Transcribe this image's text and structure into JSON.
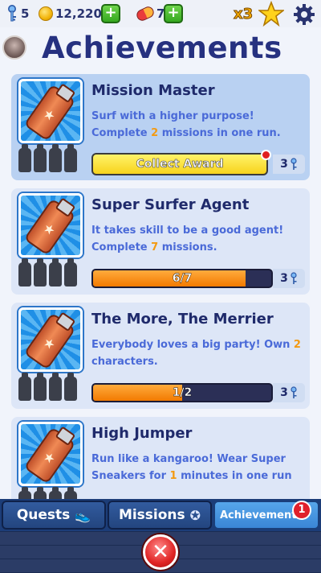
{
  "topbar": {
    "keys": "5",
    "coins": "12,220",
    "boards": "7",
    "multiplier": "x3",
    "plus": "+"
  },
  "header": {
    "title": "Achievements"
  },
  "achievements": [
    {
      "title": "Mission Master",
      "desc_pre": "Surf with a higher purpose! Complete ",
      "desc_num": "2",
      "desc_post": " missions in one run.",
      "action": "Collect Award",
      "reward": "3",
      "progress_fraction": 1.0
    },
    {
      "title": "Super Surfer Agent",
      "desc_pre": "It takes skill to be a good agent! Complete ",
      "desc_num": "7",
      "desc_post": " missions.",
      "progress": "6/7",
      "progress_fraction": 0.857,
      "reward": "3"
    },
    {
      "title": "The More, The Merrier",
      "desc_pre": "Everybody loves a big party! Own ",
      "desc_num": "2",
      "desc_post": " characters.",
      "progress": "1/2",
      "progress_fraction": 0.5,
      "reward": "3"
    },
    {
      "title": "High Jumper",
      "desc_pre": "Run like a kangaroo! Wear Super Sneakers for ",
      "desc_num": "1",
      "desc_post": " minutes in one run"
    }
  ],
  "tabs": [
    {
      "label": "Quests"
    },
    {
      "label": "Missions"
    },
    {
      "label": "Achievements",
      "badge": "1",
      "active": true
    }
  ],
  "icons": {
    "close": "close-icon",
    "settings": "gear-icon",
    "star": "star-icon"
  },
  "colors": {
    "title": "#263180",
    "accent_number": "#f39a12",
    "progress_fill": "#f27a00",
    "collect": "#f7d31c"
  }
}
